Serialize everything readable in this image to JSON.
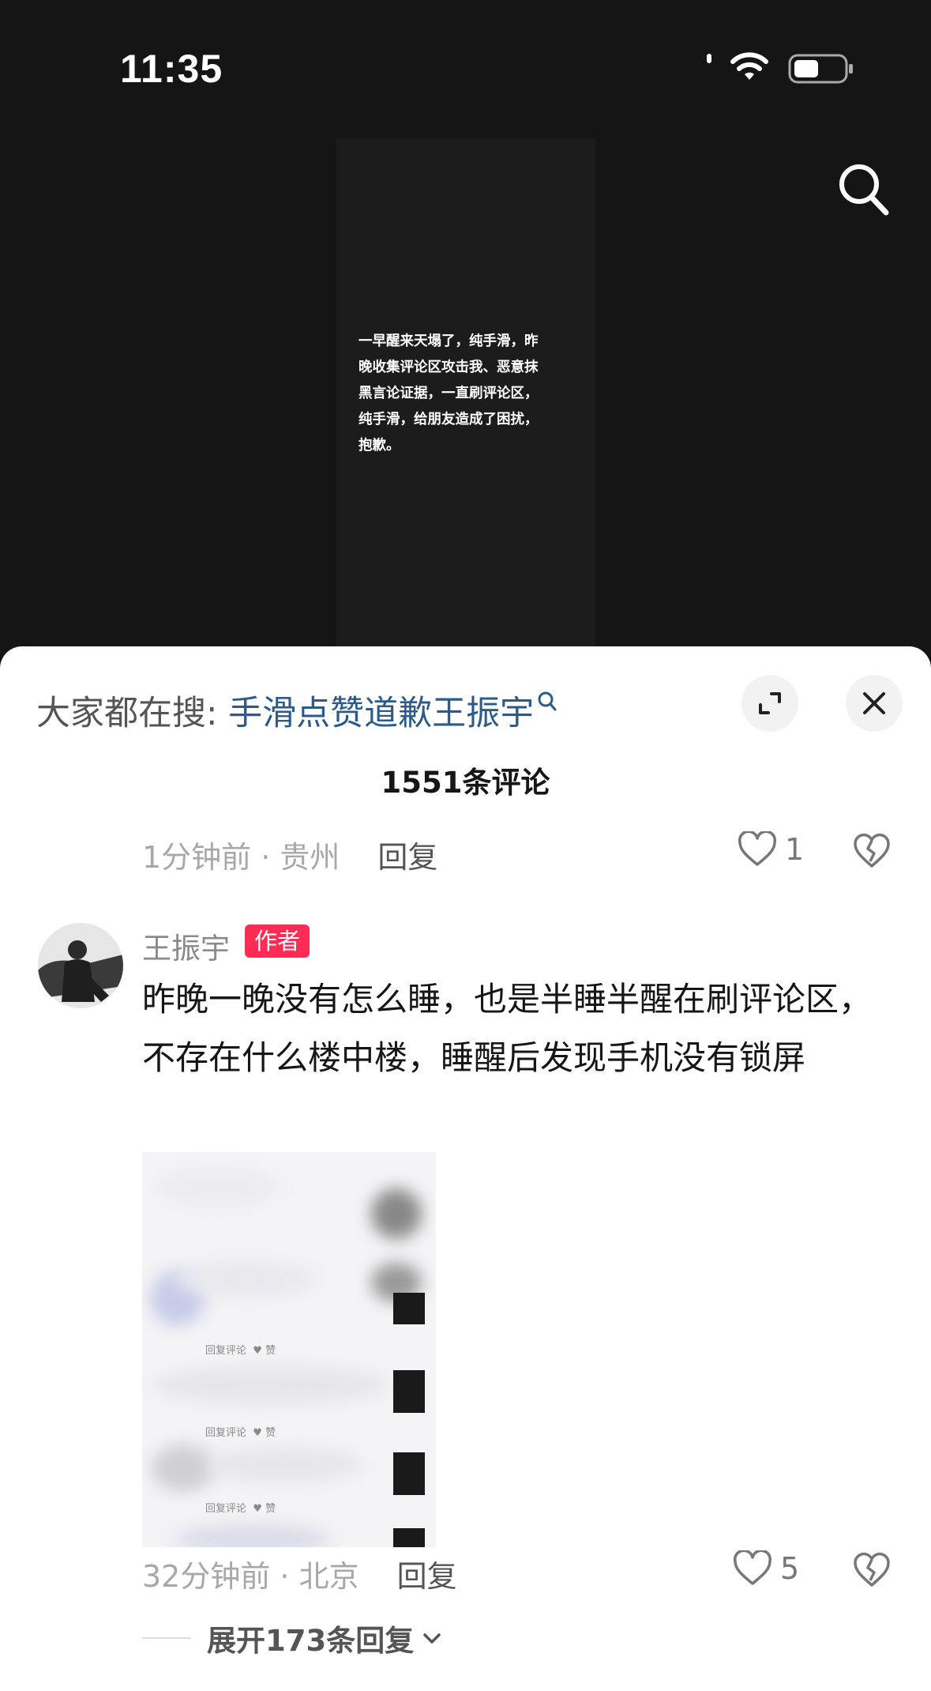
{
  "status_bar": {
    "time": "11:35"
  },
  "video": {
    "caption": "一早醒来天塌了，纯手滑，昨\n晚收集评论区攻击我、恶意抹\n黑言论证据，一直刷评论区，\n纯手滑，给朋友造成了困扰，\n抱歉。",
    "search_icon": "search-icon"
  },
  "sheet": {
    "hot_search_prefix": "大家都在搜: ",
    "hot_search_term": "手滑点赞道歉王振宇",
    "comment_count": "1551条评论",
    "prev_comment": {
      "time_location": "1分钟前 · 贵州",
      "reply_label": "回复",
      "likes": "1"
    },
    "comment": {
      "username": "王振宇",
      "author_badge": "作者",
      "text": "昨晚一晚没有怎么睡，也是半睡半醒在刷评论区，不存在什么楼中楼，睡醒后发现手机没有锁屏",
      "image_labels": {
        "reply": "回复评论",
        "like": "赞"
      },
      "time_location": "32分钟前 · 北京",
      "reply_label": "回复",
      "likes": "5",
      "expand_replies": "展开173条回复"
    }
  },
  "colors": {
    "badge": "#fe2c55",
    "link": "#2c5a8a",
    "background_dark": "#151515"
  }
}
